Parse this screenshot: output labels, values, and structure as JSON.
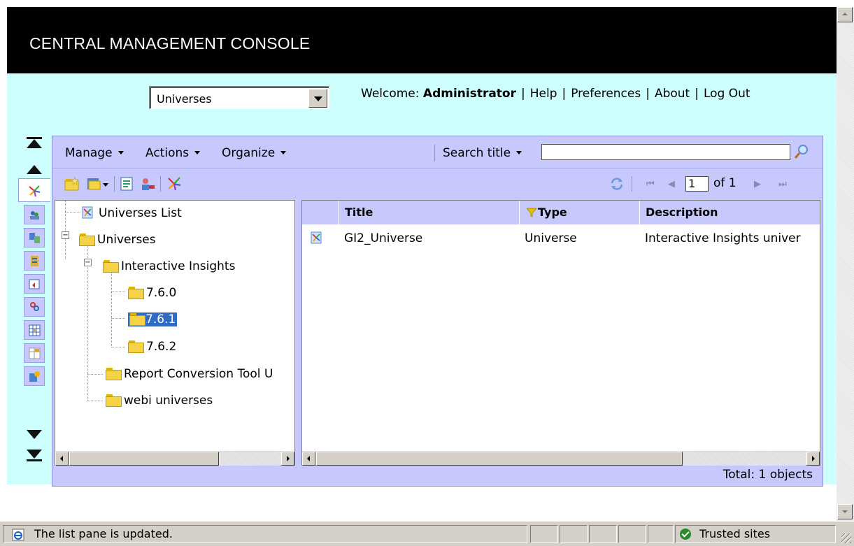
{
  "header": {
    "title": "CENTRAL MANAGEMENT CONSOLE"
  },
  "selector": {
    "value": "Universes"
  },
  "userbar": {
    "welcome": "Welcome:",
    "user": "Administrator",
    "links": [
      "Help",
      "Preferences",
      "About",
      "Log Out"
    ]
  },
  "menus": [
    "Manage",
    "Actions",
    "Organize"
  ],
  "search": {
    "label": "Search title",
    "value": ""
  },
  "pager": {
    "page": "1",
    "of": "of 1"
  },
  "tree": {
    "items": [
      {
        "label": "Universes List",
        "icon": "universe-list-icon"
      },
      {
        "label": "Universes",
        "icon": "folder-icon",
        "expanded": true
      },
      {
        "label": "Interactive Insights",
        "icon": "folder-icon",
        "expanded": true
      },
      {
        "label": "7.6.0",
        "icon": "folder-icon"
      },
      {
        "label": "7.6.1",
        "icon": "folder-open-icon",
        "selected": true
      },
      {
        "label": "7.6.2",
        "icon": "folder-icon"
      },
      {
        "label": "Report Conversion Tool U",
        "icon": "folder-icon"
      },
      {
        "label": "webi universes",
        "icon": "folder-icon"
      }
    ]
  },
  "list": {
    "columns": [
      "Title",
      "Type",
      "Description"
    ],
    "rows": [
      {
        "title": "GI2_Universe",
        "type": "Universe",
        "description": "Interactive Insights univer"
      }
    ],
    "total": "Total: 1 objects"
  },
  "statusbar": {
    "message": "The list pane is updated.",
    "zone": "Trusted sites"
  },
  "colors": {
    "header_bg": "#000000",
    "page_bg": "#ccfffe",
    "panel_bg": "#c7c8fb",
    "selection": "#316ac5"
  }
}
